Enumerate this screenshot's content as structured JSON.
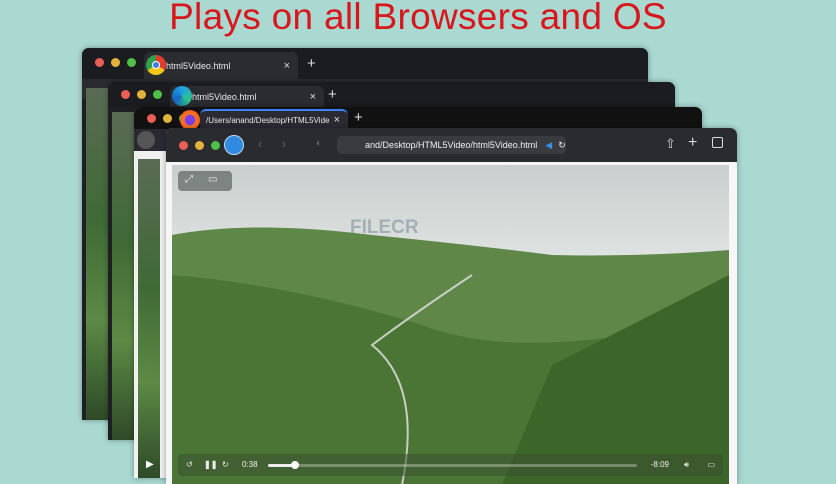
{
  "headline": "Plays on all Browsers and OS",
  "windows": [
    {
      "browser": "Chrome",
      "tab_title": "html5Video.html",
      "close": "×",
      "new_tab": "+"
    },
    {
      "browser": "Edge",
      "tab_title": "html5Video.html",
      "close": "×",
      "new_tab": "+"
    },
    {
      "browser": "Firefox",
      "tab_title": "/Users/anand/Desktop/HTML5Vide",
      "close": "×",
      "new_tab": "+"
    },
    {
      "browser": "Safari",
      "url": "and/Desktop/HTML5Video/html5Video.html"
    }
  ],
  "video": {
    "elapsed": "0:38",
    "remaining": "-8:09",
    "progress_percent": 7.2,
    "watermark": "FILECR"
  },
  "colors": {
    "headline": "#d8161c",
    "background": "#a9d9d1"
  }
}
